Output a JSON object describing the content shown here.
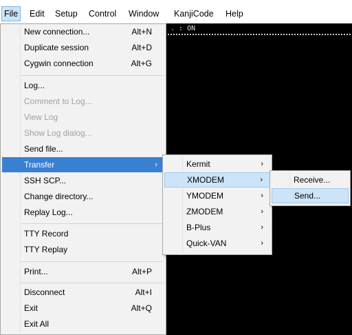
{
  "menubar": [
    {
      "label": "File",
      "active": true
    },
    {
      "label": "Edit"
    },
    {
      "label": "Setup"
    },
    {
      "label": "Control"
    },
    {
      "label": "Window"
    },
    {
      "label": "KanjiCode"
    },
    {
      "label": "Help"
    }
  ],
  "terminal": {
    "text": ". : ON"
  },
  "file_menu": {
    "items": [
      {
        "label": "New connection...",
        "shortcut": "Alt+N"
      },
      {
        "label": "Duplicate session",
        "shortcut": "Alt+D"
      },
      {
        "label": "Cygwin connection",
        "shortcut": "Alt+G"
      },
      {
        "label": "Log..."
      },
      {
        "label": "Comment to Log...",
        "disabled": true
      },
      {
        "label": "View Log",
        "disabled": true
      },
      {
        "label": "Show Log dialog...",
        "disabled": true
      },
      {
        "label": "Send file..."
      },
      {
        "label": "Transfer",
        "submenu": true,
        "selected": true
      },
      {
        "label": "SSH SCP..."
      },
      {
        "label": "Change directory..."
      },
      {
        "label": "Replay Log..."
      },
      {
        "label": "TTY Record"
      },
      {
        "label": "TTY Replay"
      },
      {
        "label": "Print...",
        "shortcut": "Alt+P"
      },
      {
        "label": "Disconnect",
        "shortcut": "Alt+I"
      },
      {
        "label": "Exit",
        "shortcut": "Alt+Q"
      },
      {
        "label": "Exit All"
      }
    ]
  },
  "transfer_menu": {
    "items": [
      {
        "label": "Kermit"
      },
      {
        "label": "XMODEM",
        "selected": true
      },
      {
        "label": "YMODEM"
      },
      {
        "label": "ZMODEM"
      },
      {
        "label": "B-Plus"
      },
      {
        "label": "Quick-VAN"
      }
    ]
  },
  "xmodem_menu": {
    "items": [
      {
        "label": "Receive..."
      },
      {
        "label": "Send...",
        "selected": true
      }
    ]
  },
  "icons": {
    "submenu_arrow": "chevron-right-icon"
  }
}
